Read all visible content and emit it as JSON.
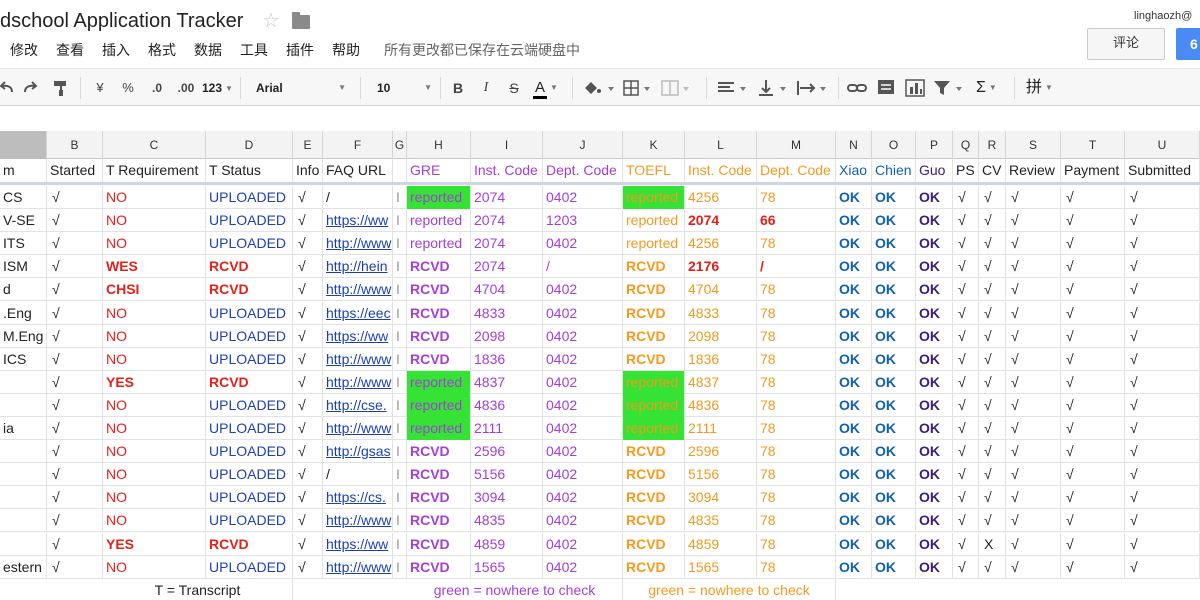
{
  "window": {
    "title": "dschool Application Tracker",
    "user_email": "linghaozh@",
    "comment_label": "评论",
    "share_label": "6",
    "save_status": "所有更改都已保存在云端硬盘中"
  },
  "menu": [
    "修改",
    "查看",
    "插入",
    "格式",
    "数据",
    "工具",
    "插件",
    "帮助"
  ],
  "toolbar": {
    "currency": "¥",
    "percent": "%",
    "dec_decrease": ".0",
    "dec_increase": ".00",
    "number_format": "123",
    "font": "Arial",
    "font_size": "10",
    "bold": "B",
    "italic": "I",
    "strike": "S",
    "text_color": "A",
    "sum": "Σ",
    "input_tool": "拼"
  },
  "columns": [
    "",
    "B",
    "C",
    "D",
    "E",
    "F",
    "G",
    "H",
    "I",
    "J",
    "K",
    "L",
    "M",
    "N",
    "O",
    "P",
    "Q",
    "R",
    "S",
    "T",
    "U"
  ],
  "header": [
    "m",
    "Started",
    "T Requirement",
    "T Status",
    "Info",
    "FAQ URL",
    "",
    "GRE",
    "Inst. Code",
    "Dept. Code",
    "TOEFL",
    "Inst. Code",
    "Dept. Code",
    "Xiao",
    "Chien",
    "Guo",
    "PS",
    "CV",
    "Review",
    "Payment",
    "Submitted"
  ],
  "rows": [
    [
      "CS",
      "√",
      "NO",
      "UPLOADED",
      "√",
      "/",
      "I",
      "reported",
      "2074",
      "0402",
      "reported",
      "4256",
      "78",
      "OK",
      "OK",
      "OK",
      "√",
      "√",
      "√",
      "√",
      "√"
    ],
    [
      "V-SE",
      "√",
      "NO",
      "UPLOADED",
      "√",
      "https://ww",
      "I",
      "reported",
      "2074",
      "1203",
      "reported",
      "2074",
      "66",
      "OK",
      "OK",
      "OK",
      "√",
      "√",
      "√",
      "√",
      "√"
    ],
    [
      "ITS",
      "√",
      "NO",
      "UPLOADED",
      "√",
      "http://www",
      "I",
      "reported",
      "2074",
      "0402",
      "reported",
      "4256",
      "78",
      "OK",
      "OK",
      "OK",
      "√",
      "√",
      "√",
      "√",
      "√"
    ],
    [
      "ISM",
      "√",
      "WES",
      "RCVD",
      "√",
      "http://hein",
      "I",
      "RCVD",
      "2074",
      "/",
      "RCVD",
      "2176",
      "/",
      "OK",
      "OK",
      "OK",
      "√",
      "√",
      "√",
      "√",
      "√"
    ],
    [
      "d",
      "√",
      "CHSI",
      "RCVD",
      "√",
      "http://www",
      "I",
      "RCVD",
      "4704",
      "0402",
      "RCVD",
      "4704",
      "78",
      "OK",
      "OK",
      "OK",
      "√",
      "√",
      "√",
      "√",
      "√"
    ],
    [
      ".Eng",
      "√",
      "NO",
      "UPLOADED",
      "√",
      "https://eec",
      "I",
      "RCVD",
      "4833",
      "0402",
      "RCVD",
      "4833",
      "78",
      "OK",
      "OK",
      "OK",
      "√",
      "√",
      "√",
      "√",
      "√"
    ],
    [
      "M.Eng",
      "√",
      "NO",
      "UPLOADED",
      "√",
      "https://ww",
      "I",
      "RCVD",
      "2098",
      "0402",
      "RCVD",
      "2098",
      "78",
      "OK",
      "OK",
      "OK",
      "√",
      "√",
      "√",
      "√",
      "√"
    ],
    [
      "ICS",
      "√",
      "NO",
      "UPLOADED",
      "√",
      "http://www",
      "I",
      "RCVD",
      "1836",
      "0402",
      "RCVD",
      "1836",
      "78",
      "OK",
      "OK",
      "OK",
      "√",
      "√",
      "√",
      "√",
      "√"
    ],
    [
      "",
      "√",
      "YES",
      "RCVD",
      "√",
      "http://www",
      "I",
      "reported",
      "4837",
      "0402",
      "reported",
      "4837",
      "78",
      "OK",
      "OK",
      "OK",
      "√",
      "√",
      "√",
      "√",
      "√"
    ],
    [
      "",
      "√",
      "NO",
      "UPLOADED",
      "√",
      "http://cse.",
      "I",
      "reported",
      "4836",
      "0402",
      "reported",
      "4836",
      "78",
      "OK",
      "OK",
      "OK",
      "√",
      "√",
      "√",
      "√",
      "√"
    ],
    [
      "ia",
      "√",
      "NO",
      "UPLOADED",
      "√",
      "http://www",
      "I",
      "reported",
      "2111",
      "0402",
      "reported",
      "2111",
      "78",
      "OK",
      "OK",
      "OK",
      "√",
      "√",
      "√",
      "√",
      "√"
    ],
    [
      "",
      "√",
      "NO",
      "UPLOADED",
      "√",
      "http://gsas",
      "I",
      "RCVD",
      "2596",
      "0402",
      "RCVD",
      "2596",
      "78",
      "OK",
      "OK",
      "OK",
      "√",
      "√",
      "√",
      "√",
      "√"
    ],
    [
      "",
      "√",
      "NO",
      "UPLOADED",
      "√",
      "/",
      "I",
      "RCVD",
      "5156",
      "0402",
      "RCVD",
      "5156",
      "78",
      "OK",
      "OK",
      "OK",
      "√",
      "√",
      "√",
      "√",
      "√"
    ],
    [
      "",
      "√",
      "NO",
      "UPLOADED",
      "√",
      "https://cs.",
      "I",
      "RCVD",
      "3094",
      "0402",
      "RCVD",
      "3094",
      "78",
      "OK",
      "OK",
      "OK",
      "√",
      "√",
      "√",
      "√",
      "√"
    ],
    [
      "",
      "√",
      "NO",
      "UPLOADED",
      "√",
      "http://www",
      "I",
      "RCVD",
      "4835",
      "0402",
      "RCVD",
      "4835",
      "78",
      "OK",
      "OK",
      "OK",
      "√",
      "√",
      "√",
      "√",
      "√"
    ],
    [
      "",
      "√",
      "YES",
      "RCVD",
      "√",
      "https://ww",
      "I",
      "RCVD",
      "4859",
      "0402",
      "RCVD",
      "4859",
      "78",
      "OK",
      "OK",
      "OK",
      "√",
      "X",
      "√",
      "√",
      "√"
    ],
    [
      "estern",
      "√",
      "NO",
      "UPLOADED",
      "√",
      "http://www",
      "I",
      "RCVD",
      "1565",
      "0402",
      "RCVD",
      "1565",
      "78",
      "OK",
      "OK",
      "OK",
      "√",
      "√",
      "√",
      "√",
      "√"
    ]
  ],
  "footer": {
    "transcript_note": "T = Transcript",
    "gre_note": "green = nowhere to check",
    "toefl_note": "green = nowhere to check"
  },
  "colors": {
    "red": "#e3211b",
    "blue": "#1f3fb5",
    "purple": "#a43fd6",
    "orange": "#f39a1f",
    "green_fill": "#34e334",
    "ok_blue": "#1060b0",
    "guo_purple": "#3a1d7a"
  }
}
